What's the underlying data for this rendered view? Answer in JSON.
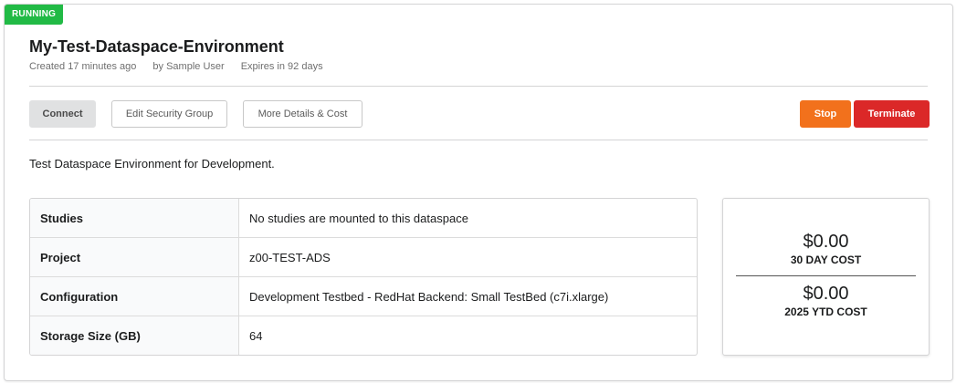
{
  "status": "RUNNING",
  "environment": {
    "title": "My-Test-Dataspace-Environment",
    "created": "Created 17 minutes ago",
    "owner": "by Sample User",
    "expires": "Expires in 92 days",
    "description": "Test Dataspace Environment for Development."
  },
  "actions": {
    "connect": "Connect",
    "edit_security_group": "Edit Security Group",
    "more_details": "More Details & Cost",
    "stop": "Stop",
    "terminate": "Terminate"
  },
  "details": [
    {
      "label": "Studies",
      "value": "No studies are mounted to this dataspace"
    },
    {
      "label": "Project",
      "value": "z00-TEST-ADS"
    },
    {
      "label": "Configuration",
      "value": "Development Testbed - RedHat Backend: Small TestBed (c7i.xlarge)"
    },
    {
      "label": "Storage Size (GB)",
      "value": "64"
    }
  ],
  "costs": {
    "thirty_day_amount": "$0.00",
    "thirty_day_label": "30 DAY COST",
    "ytd_amount": "$0.00",
    "ytd_label": "2025 YTD COST"
  },
  "colors": {
    "running": "#21ba45",
    "stop": "#f2711c",
    "terminate": "#db2828"
  }
}
